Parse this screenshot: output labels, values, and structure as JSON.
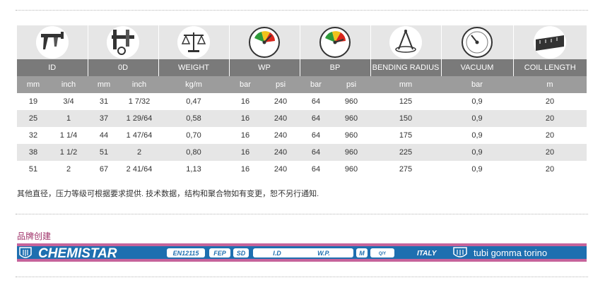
{
  "headers": [
    "ID",
    "0D",
    "WEIGHT",
    "WP",
    "BP",
    "BENDING RADIUS",
    "VACUUM",
    "COIL LENGTH"
  ],
  "icons": [
    "caliper-id-icon",
    "caliper-od-icon",
    "scale-icon",
    "pressure-gauge-icon",
    "pressure-gauge-icon",
    "bending-radius-icon",
    "vacuum-gauge-icon",
    "tape-measure-icon"
  ],
  "units": [
    "mm",
    "inch",
    "mm",
    "inch",
    "kg/m",
    "bar",
    "psi",
    "bar",
    "psi",
    "mm",
    "bar",
    "m"
  ],
  "rows": [
    [
      "19",
      "3/4",
      "31",
      "1 7/32",
      "0,47",
      "16",
      "240",
      "64",
      "960",
      "125",
      "0,9",
      "20"
    ],
    [
      "25",
      "1",
      "37",
      "1 29/64",
      "0,58",
      "16",
      "240",
      "64",
      "960",
      "150",
      "0,9",
      "20"
    ],
    [
      "32",
      "1 1/4",
      "44",
      "1 47/64",
      "0,70",
      "16",
      "240",
      "64",
      "960",
      "175",
      "0,9",
      "20"
    ],
    [
      "38",
      "1 1/2",
      "51",
      "2",
      "0,80",
      "16",
      "240",
      "64",
      "960",
      "225",
      "0,9",
      "20"
    ],
    [
      "51",
      "2",
      "67",
      "2 41/64",
      "1,13",
      "16",
      "240",
      "64",
      "960",
      "275",
      "0,9",
      "20"
    ]
  ],
  "note": "其他直径，压力等级可根据要求提供. 技术数据，结构和聚合物如有变更，恕不另行通知.",
  "brand_section_title": "品牌创建",
  "banner": {
    "product_name": "CHEMISTAR",
    "tags": [
      "EN12115",
      "FEP",
      "SD",
      "I.D",
      "W.P.",
      "M",
      "Q/Y"
    ],
    "country": "ITALY",
    "company": "tubi gomma torino",
    "colors": {
      "blue": "#1e6fb0",
      "pink": "#c6639b",
      "white": "#ffffff"
    }
  }
}
